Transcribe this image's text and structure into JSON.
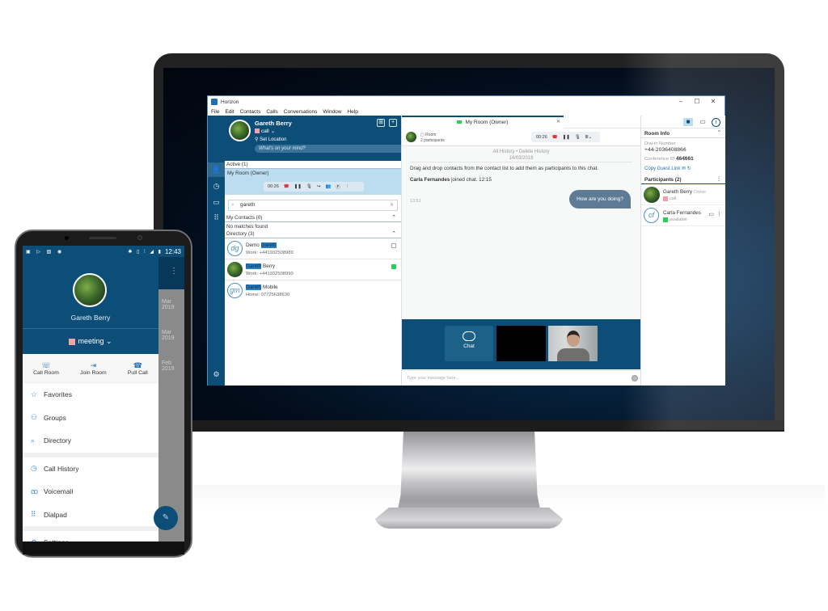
{
  "desktop_app": {
    "window_title": "Horizon",
    "window_controls": {
      "minimize": "–",
      "maximize": "☐",
      "close": "✕"
    },
    "menu": [
      "File",
      "Edit",
      "Contacts",
      "Calls",
      "Conversations",
      "Window",
      "Help"
    ],
    "profile": {
      "name": "Gareth Berry",
      "status": "call",
      "location": "Set Location",
      "mind_placeholder": "What's on your mind?"
    },
    "rail_icons": [
      "contacts-icon",
      "call-history-icon",
      "chat-icon",
      "dialpad-icon",
      "settings-icon"
    ],
    "active": {
      "header": "Active (1)",
      "room": "My Room (Owner)",
      "call_timer": "00:26"
    },
    "search": {
      "value": "gareth"
    },
    "my_contacts": {
      "header": "My Contacts (0)",
      "empty": "No matches found"
    },
    "directory": {
      "header": "Directory (3)",
      "items": [
        {
          "initials": "dg",
          "name_pre": "Demo ",
          "highlight": "Gareth",
          "name_post": "",
          "phone": "Work: +441932508989",
          "presence": "none"
        },
        {
          "initials": "",
          "name_pre": "",
          "highlight": "Gareth",
          "name_post": " Berry",
          "phone": "Work: +441932508990",
          "presence": "available"
        },
        {
          "initials": "gm",
          "name_pre": "",
          "highlight": "Gareth",
          "name_post": " Mobile",
          "phone": "Home: 07725638630",
          "presence": ""
        }
      ]
    },
    "chat": {
      "tab_label": "My Room (Owner)",
      "room_type": "Room",
      "participants_count": "2 participants",
      "call_timer": "00:26",
      "history_links": "All History  •  Delete History",
      "date": "14/03/2019",
      "system_message": "Drag and drop contacts from the contact list to add them as participants to this chat.",
      "join_name": "Carla Fernandes",
      "join_text": " joined chat. 12:15",
      "message_time": "13:51",
      "message": "How are you doing?",
      "chat_tile_label": "Chat",
      "input_placeholder": "Type your message here..."
    },
    "room_info": {
      "header": "Room Info",
      "dial_in_label": "Dial-in Number",
      "dial_in_number": "+44-2036408866",
      "conference_label": "Conference ID",
      "conference_id": "464661",
      "copy_guest_link": "Copy Guest Link",
      "participants_header": "Participants (2)",
      "participants": [
        {
          "name": "Gareth Berry",
          "role": "Owner",
          "status": "call"
        },
        {
          "initials": "cf",
          "name": "Carla Fernandes",
          "role": "",
          "status": "available"
        }
      ]
    }
  },
  "mobile_app": {
    "status_bar_time": "12:43",
    "user_name": "Gareth Berry",
    "status": "meeting",
    "actions": [
      "Call Room",
      "Join Room",
      "Pull Call"
    ],
    "menu_group1": [
      "Favorites",
      "Groups",
      "Directory"
    ],
    "menu_group2": [
      "Call History",
      "Voicemail",
      "Dialpad"
    ],
    "menu_partial": "Settings",
    "background_dates": [
      "Mar 2019",
      "Mar 2019",
      "Feb 2019"
    ]
  },
  "colors": {
    "brand": "#0c4e78",
    "available": "#2ecc5a",
    "busy": "#f3a0a6",
    "hangup": "#e0333b",
    "bubble": "#5e7b95"
  }
}
